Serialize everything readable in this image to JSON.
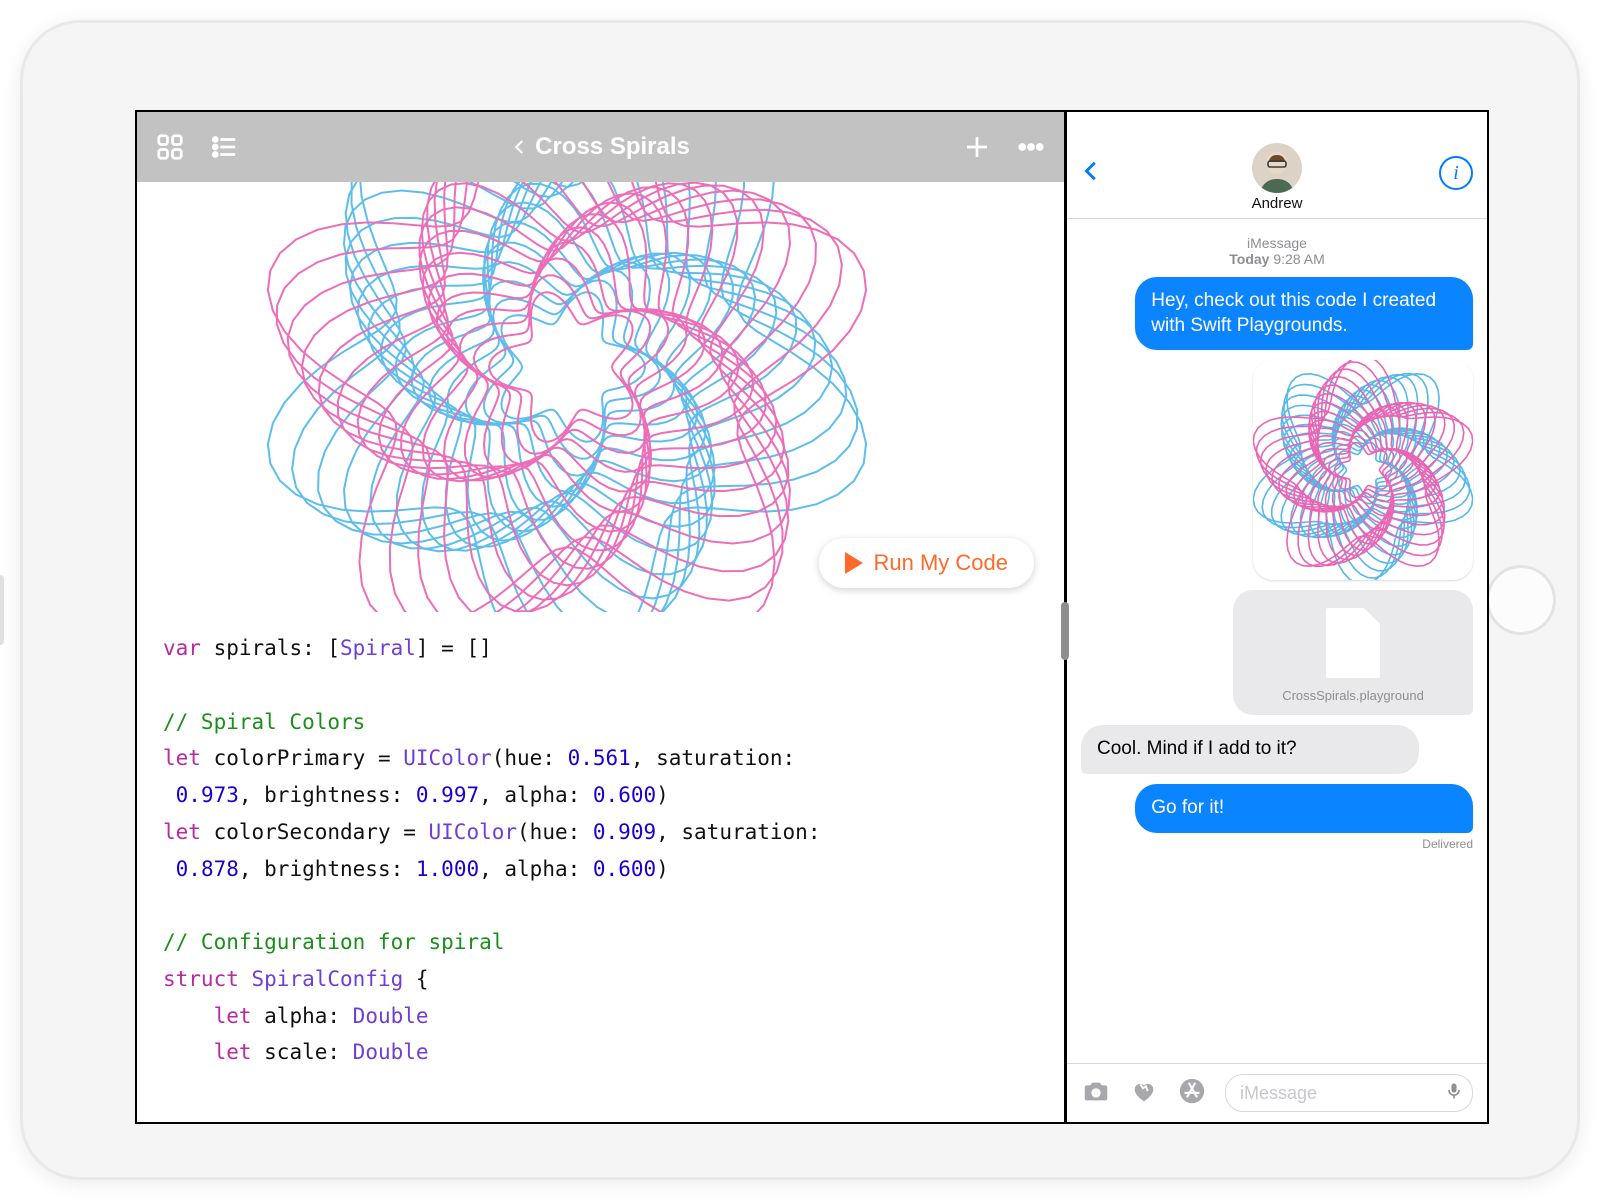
{
  "playground": {
    "title": "Cross Spirals",
    "run_label": "Run My Code",
    "code_lines": [
      {
        "type": "code",
        "seg": [
          [
            "kw",
            "var"
          ],
          [
            "pl",
            " spirals: ["
          ],
          [
            "ty",
            "Spiral"
          ],
          [
            "pl",
            "] = []"
          ]
        ]
      },
      {
        "type": "blank"
      },
      {
        "type": "code",
        "seg": [
          [
            "cm",
            "// Spiral Colors"
          ]
        ]
      },
      {
        "type": "code",
        "seg": [
          [
            "kw",
            "let"
          ],
          [
            "pl",
            " colorPrimary = "
          ],
          [
            "ty",
            "UIColor"
          ],
          [
            "pl",
            "(hue: "
          ],
          [
            "nm",
            "0.561"
          ],
          [
            "pl",
            ", saturation:"
          ]
        ]
      },
      {
        "type": "code",
        "seg": [
          [
            "pl",
            " "
          ],
          [
            "nm",
            "0.973"
          ],
          [
            "pl",
            ", brightness: "
          ],
          [
            "nm",
            "0.997"
          ],
          [
            "pl",
            ", alpha: "
          ],
          [
            "nm",
            "0.600"
          ],
          [
            "pl",
            ")"
          ]
        ]
      },
      {
        "type": "code",
        "seg": [
          [
            "kw",
            "let"
          ],
          [
            "pl",
            " colorSecondary = "
          ],
          [
            "ty",
            "UIColor"
          ],
          [
            "pl",
            "(hue: "
          ],
          [
            "nm",
            "0.909"
          ],
          [
            "pl",
            ", saturation:"
          ]
        ]
      },
      {
        "type": "code",
        "seg": [
          [
            "pl",
            " "
          ],
          [
            "nm",
            "0.878"
          ],
          [
            "pl",
            ", brightness: "
          ],
          [
            "nm",
            "1.000"
          ],
          [
            "pl",
            ", alpha: "
          ],
          [
            "nm",
            "0.600"
          ],
          [
            "pl",
            ")"
          ]
        ]
      },
      {
        "type": "blank"
      },
      {
        "type": "code",
        "seg": [
          [
            "cm",
            "// Configuration for spiral"
          ]
        ]
      },
      {
        "type": "code",
        "seg": [
          [
            "kw",
            "struct"
          ],
          [
            "pl",
            " "
          ],
          [
            "ty",
            "SpiralConfig"
          ],
          [
            "pl",
            " {"
          ]
        ]
      },
      {
        "type": "code",
        "seg": [
          [
            "pl",
            "    "
          ],
          [
            "kw",
            "let"
          ],
          [
            "pl",
            " alpha: "
          ],
          [
            "ty",
            "Double"
          ]
        ]
      },
      {
        "type": "code",
        "seg": [
          [
            "pl",
            "    "
          ],
          [
            "kw",
            "let"
          ],
          [
            "pl",
            " scale: "
          ],
          [
            "ty",
            "Double"
          ]
        ]
      }
    ]
  },
  "messages": {
    "contact": "Andrew",
    "service": "iMessage",
    "stamp_day": "Today",
    "stamp_time": "9:28 AM",
    "thread": [
      {
        "dir": "out",
        "text": "Hey, check out this code I created with Swift Playgrounds."
      },
      {
        "dir": "out",
        "kind": "image"
      },
      {
        "dir": "out",
        "kind": "file",
        "filename": "CrossSpirals.playground"
      },
      {
        "dir": "in",
        "text": "Cool. Mind if I add to it?"
      },
      {
        "dir": "out",
        "text": "Go for it!"
      }
    ],
    "delivered": "Delivered",
    "compose_placeholder": "iMessage"
  }
}
